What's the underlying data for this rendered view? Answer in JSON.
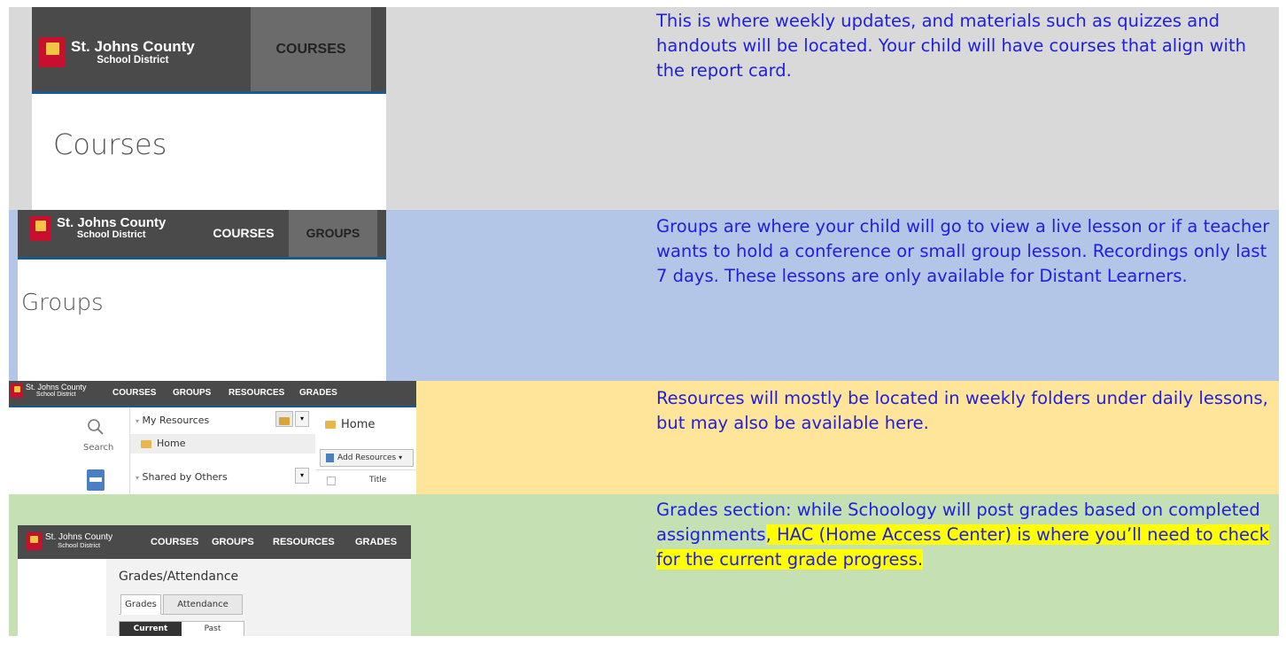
{
  "district": {
    "name": "St. Johns County",
    "sub": "School District"
  },
  "sections": [
    {
      "nav": [
        "COURSES"
      ],
      "page_title": "Courses",
      "description": "This is where weekly updates, and materials such as quizzes and handouts will be located.  Your child will have courses that align with the report card."
    },
    {
      "nav": [
        "COURSES",
        "GROUPS"
      ],
      "page_title": "Groups",
      "description": "Groups are where your child will go to view a live lesson or if a teacher wants to hold a conference or small group lesson.  Recordings only last 7 days. These lessons are only available for Distant Learners."
    },
    {
      "nav": [
        "COURSES",
        "GROUPS",
        "RESOURCES",
        "GRADES"
      ],
      "search_label": "Search",
      "my_resources": "My Resources",
      "home_item": "Home",
      "shared": "Shared by Others",
      "home_title": "Home",
      "add_resources": "Add Resources",
      "title_col": "Title",
      "description": "Resources will mostly be located in weekly folders under daily lessons, but may also be available here."
    },
    {
      "nav": [
        "COURSES",
        "GROUPS",
        "RESOURCES",
        "GRADES"
      ],
      "page_title": "Grades/Attendance",
      "tabs": [
        "Grades",
        "Attendance"
      ],
      "toggle": [
        "Current",
        "Past"
      ],
      "description_plain": "Grades section: while Schoology will post grades based on completed assignments",
      "description_highlight": ", HAC (Home Access Center) is where you’ll need to check for the current grade progress."
    }
  ],
  "colors": {
    "row1": "#d9d9d9",
    "row2": "#b4c6e7",
    "row3": "#ffe599",
    "row4": "#c5e0b3",
    "text": "#1f1fe0",
    "highlight": "#ffff00"
  }
}
